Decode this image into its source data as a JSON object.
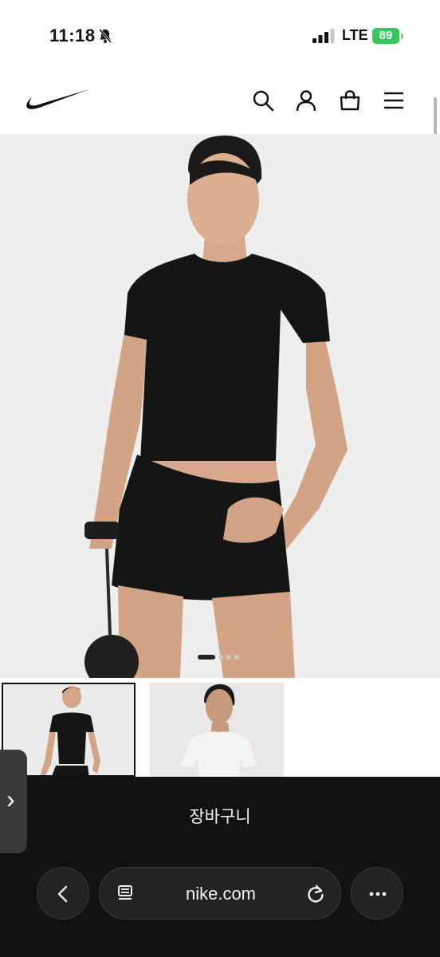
{
  "status": {
    "time": "11:18",
    "network": "LTE",
    "battery": "89"
  },
  "header": {
    "logo": "nike-swoosh",
    "icons": [
      "search-icon",
      "user-icon",
      "bag-icon",
      "menu-icon"
    ]
  },
  "carousel": {
    "slides": 4,
    "active_index": 0
  },
  "thumbnails": {
    "items": [
      "black-top-thumbnail",
      "white-top-thumbnail"
    ],
    "selected_index": 0
  },
  "cart": {
    "label": "장바구니"
  },
  "browser": {
    "url": "nike.com"
  },
  "colors": {
    "battery": "#34c759",
    "sheet": "#121212",
    "toolbar_button": "#232325"
  }
}
